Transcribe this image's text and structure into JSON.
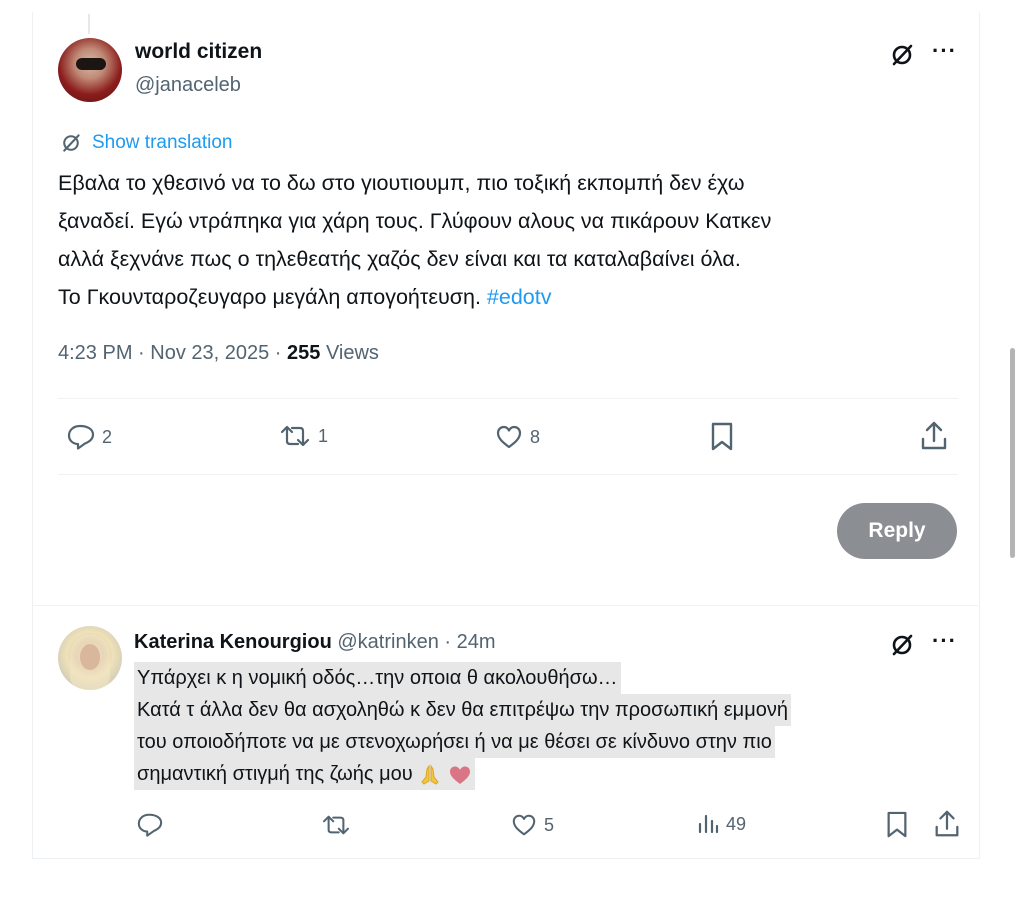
{
  "tweet": {
    "author_name": "world citizen",
    "author_handle": "@janaceleb",
    "show_translation": "Show translation",
    "text_lines": [
      "Εβαλα το χθεσινό να το δω στο γιουτιουμπ, πιο τοξική εκπομπή δεν έχω",
      "ξαναδεί. Εγώ ντράπηκα για χάρη τους. Γλύφουν αλους να πικάρουν Κατκεν",
      "αλλά ξεχνάνε  πως ο τηλεθεατής χαζός δεν είναι και τα καταλαβαίνει όλα.",
      "Το Γκουνταροζευγαρο μεγάλη απογοήτευση."
    ],
    "hashtag": "#edotv",
    "timestamp": "4:23 PM · Nov 23, 2025 · ",
    "views_count": "255",
    "views_label": " Views",
    "more_icon": "···",
    "actions": {
      "replies": "2",
      "reposts": "1",
      "likes": "8"
    }
  },
  "reply_button": "Reply",
  "reply_tweet": {
    "author_name": "Katerina Kenourgiou",
    "author_handle": "@katrinken",
    "time": " · 24m",
    "more_icon": "···",
    "text_lines": [
      "Υπάρχει κ η νομική οδός…την οποια θ ακολουθήσω…",
      "Κατά τ άλλα δεν θα ασχοληθώ κ δεν θα επιτρέψω την προσωπική εμμονή",
      "του οποιοδήποτε να με στενοχωρήσει ή να με θέσει σε κίνδυνο στην πιο",
      "σημαντική στιγμή της ζωής μου"
    ],
    "emojis": [
      "praying-hands",
      "heart"
    ],
    "actions": {
      "likes": "5",
      "views": "49"
    }
  },
  "colors": {
    "link": "#1d9bf0",
    "secondary_text": "#536471",
    "reply_button_bg": "#8b8f93",
    "highlight": "#e7e7e7"
  }
}
